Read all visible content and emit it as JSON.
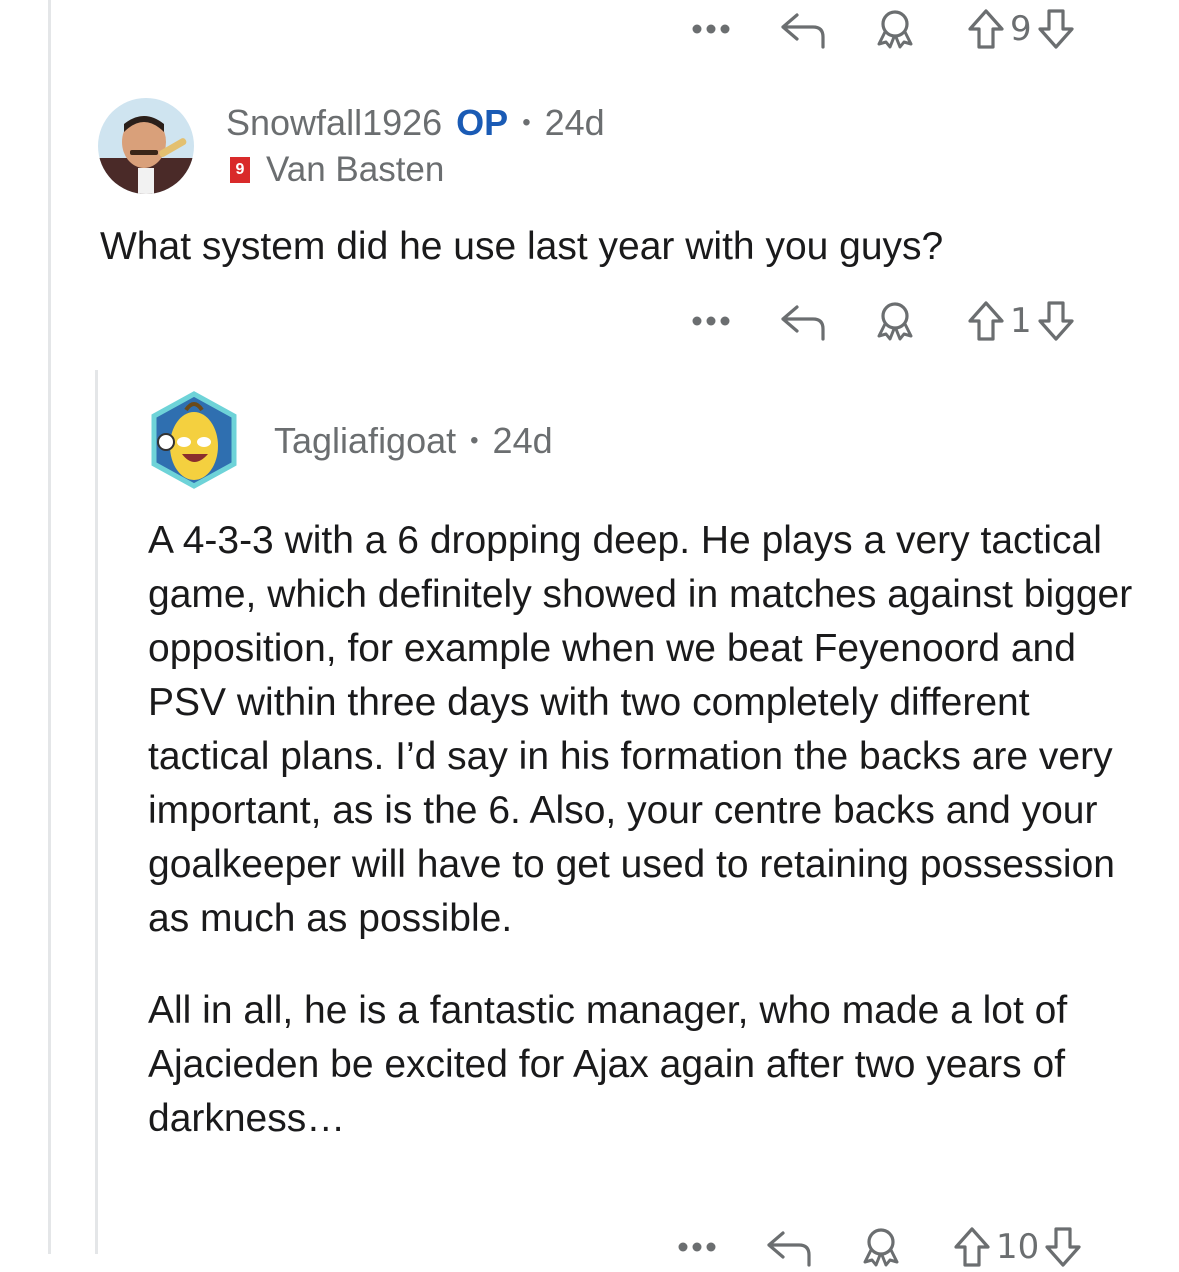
{
  "top_actions": {
    "more_label": "•••",
    "votes": "9"
  },
  "comment1": {
    "username": "Snowfall1926",
    "op_label": "OP",
    "separator": "•",
    "age": "24d",
    "flair_badge": "9",
    "flair_text": "Van Basten",
    "body": "What system did he use last year with you guys?",
    "actions": {
      "more_label": "•••",
      "votes": "1"
    }
  },
  "comment2": {
    "username": "Tagliafigoat",
    "separator": "•",
    "age": "24d",
    "paragraphs": [
      "A 4-3-3 with a 6 dropping deep. He plays a very tactical game, which definitely showed in matches against bigger opposition, for example when we beat Feyenoord and PSV within three days with two completely different tactical plans. I’d say in his formation the backs are very important, as is the 6. Also, your centre backs and your goalkeeper will have to get used to retaining possession as much as possible.",
      "All in all, he is a fantastic manager, who made a lot of Ajacieden be excited for Ajax again after two years of darkness…"
    ],
    "actions": {
      "more_label": "•••",
      "votes": "10"
    }
  },
  "colors": {
    "text": "#1a1a1b",
    "meta": "#6b6e70",
    "op": "#1a5bb5",
    "thread_line": "#e4e6e8",
    "flair_badge": "#d92a2a"
  },
  "icons": [
    "more-icon",
    "reply-icon",
    "award-icon",
    "upvote-icon",
    "downvote-icon"
  ]
}
